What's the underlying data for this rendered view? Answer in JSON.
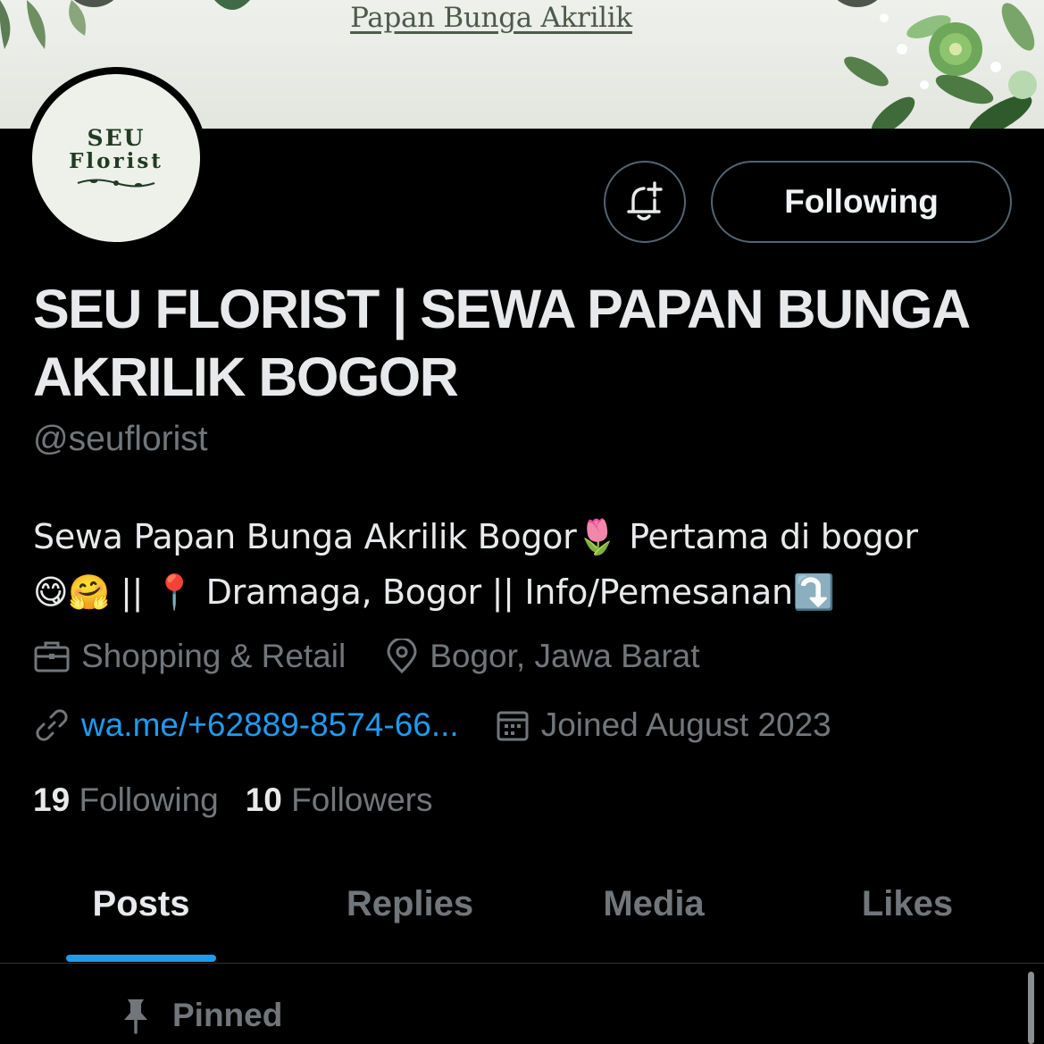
{
  "banner": {
    "title": "Papan Bunga Akrilik"
  },
  "avatar": {
    "line1": "SEU",
    "line2": "Florist"
  },
  "actions": {
    "notify_icon": "bell-plus-icon",
    "follow_label": "Following"
  },
  "profile": {
    "name": "SEU FLORIST | SEWA PAPAN BUNGA AKRILIK BOGOR",
    "handle": "@seuflorist",
    "bio_line1": "Sewa Papan Bunga Akrilik Bogor🌷  Pertama di bogor",
    "bio_line2": "😋🤗 || 📍 Dramaga, Bogor || Info/Pemesanan⤵️"
  },
  "meta": {
    "category": "Shopping & Retail",
    "location": "Bogor, Jawa Barat",
    "link": "wa.me/+62889-8574-66...",
    "joined": "Joined August 2023"
  },
  "stats": {
    "following_count": "19",
    "following_label": "Following",
    "followers_count": "10",
    "followers_label": "Followers"
  },
  "tabs": [
    {
      "label": "Posts",
      "active": true
    },
    {
      "label": "Replies",
      "active": false
    },
    {
      "label": "Media",
      "active": false
    },
    {
      "label": "Likes",
      "active": false
    }
  ],
  "pinned": {
    "label": "Pinned"
  },
  "colors": {
    "accent": "#1d9bf0",
    "background": "#000000",
    "muted": "#71767b",
    "text": "#e7e9ea"
  }
}
